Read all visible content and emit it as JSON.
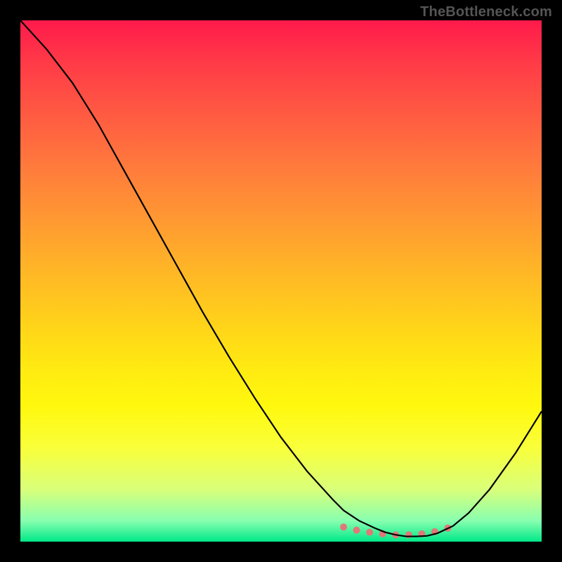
{
  "watermark": "TheBottleneck.com",
  "chart_data": {
    "type": "line",
    "title": "",
    "xlabel": "",
    "ylabel": "",
    "xlim": [
      0,
      100
    ],
    "ylim": [
      0,
      100
    ],
    "x": [
      0,
      5,
      10,
      15,
      20,
      25,
      30,
      35,
      40,
      45,
      50,
      55,
      60,
      62,
      65,
      68,
      70,
      72,
      74,
      76,
      78,
      80,
      83,
      86,
      90,
      95,
      100
    ],
    "values": [
      100,
      94.5,
      88,
      80,
      71,
      62,
      53,
      44,
      35.5,
      27.5,
      20,
      13.5,
      8,
      6,
      4,
      2.6,
      1.8,
      1.3,
      1.0,
      1.0,
      1.1,
      1.6,
      3.0,
      5.5,
      10,
      17,
      25
    ],
    "markers": {
      "x": [
        62,
        64.5,
        67,
        69.5,
        72,
        74.5,
        77,
        79.5,
        82
      ],
      "y": [
        2.8,
        2.2,
        1.8,
        1.5,
        1.3,
        1.3,
        1.5,
        1.9,
        2.6
      ],
      "color": "#e07878",
      "size": 10
    },
    "line_color": "#000000",
    "line_width": 2.2
  }
}
